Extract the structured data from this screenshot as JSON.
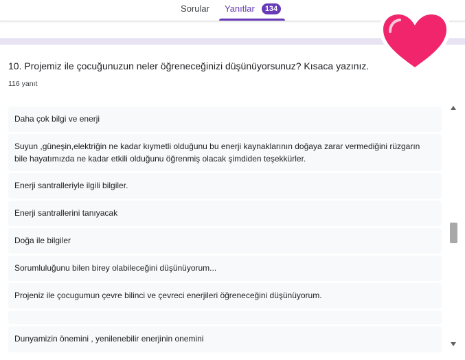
{
  "tabs": {
    "questions_label": "Sorular",
    "responses_label": "Yanıtlar",
    "responses_count": "134"
  },
  "question": {
    "title": "10. Projemiz ile çocuğunuzun neler öğreneceğinizi düşünüyorsunuz? Kısaca yazınız.",
    "response_count": "116 yanıt"
  },
  "responses": [
    "Daha çok bilgi ve enerji",
    "Suyun ,güneşin,elektriğin ne kadar kıymetli olduğunu bu enerji kaynaklarının doğaya zarar vermediğini rüzgarın bile hayatımızda ne kadar etkili olduğunu öğrenmiş olacak şimdiden teşekkürler.",
    "Enerji santralleriyle ilgili bilgiler.",
    "Enerji santrallerini tanıyacak",
    "Doğa ile bilgiler",
    "Sorumluluğunu bilen birey olabileceğini düşünüyorum...",
    "Projeniz ile çocugumun çevre bilinci ve çevreci enerjileri öğreneceğini düşünüyorum.",
    "",
    "Dunyamizin önemini , yenilenebilir enerjinin onemini"
  ],
  "colors": {
    "accent": "#673ab7",
    "heart": "#f0256b",
    "card_bg": "#f8f9fa"
  },
  "icons": {
    "sticker": "heart-icon",
    "scroll_up": "scroll-up-arrow-icon",
    "scroll_down": "scroll-down-arrow-icon"
  }
}
